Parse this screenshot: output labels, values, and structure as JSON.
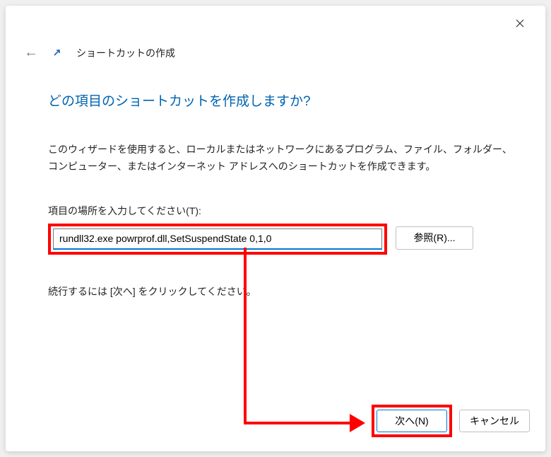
{
  "header": {
    "wizard_title": "ショートカットの作成"
  },
  "content": {
    "question": "どの項目のショートカットを作成しますか?",
    "description": "このウィザードを使用すると、ローカルまたはネットワークにあるプログラム、ファイル、フォルダー、コンピューター、またはインターネット アドレスへのショートカットを作成できます。",
    "input_label": "項目の場所を入力してください(T):",
    "input_value": "rundll32.exe powrprof.dll,SetSuspendState 0,1,0",
    "browse_label": "参照(R)...",
    "continue_text": "続行するには [次へ] をクリックしてください。"
  },
  "footer": {
    "next_label": "次へ(N)",
    "cancel_label": "キャンセル"
  }
}
